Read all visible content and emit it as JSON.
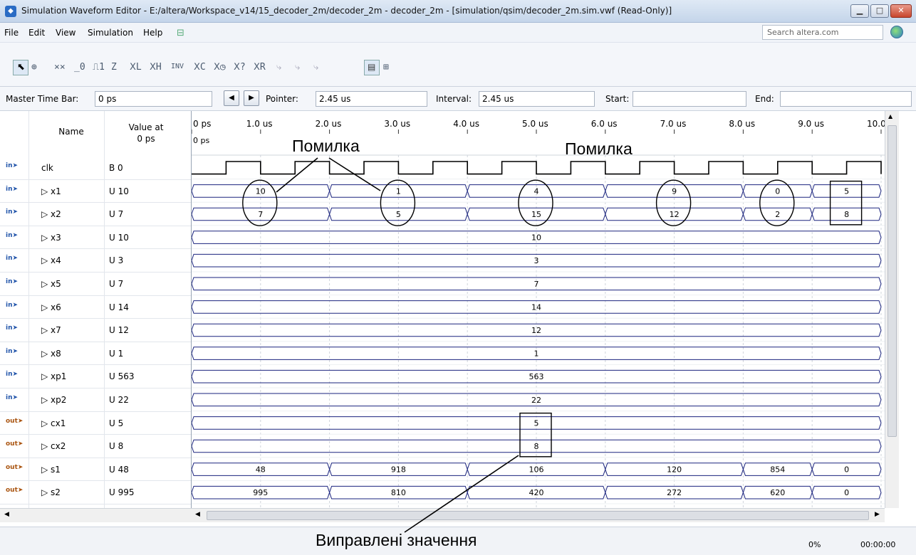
{
  "window": {
    "title": "Simulation Waveform Editor - E:/altera/Workspace_v14/15_decoder_2m/decoder_2m - decoder_2m - [simulation/qsim/decoder_2m.sim.vwf (Read-Only)]"
  },
  "menu": {
    "items": [
      "File",
      "Edit",
      "View",
      "Simulation",
      "Help"
    ]
  },
  "search": {
    "placeholder": "Search altera.com"
  },
  "toolbar": {
    "icons": [
      "select-icon",
      "zoom-icon",
      "uninitialized-icon",
      "forcing-low-icon",
      "forcing-high-icon",
      "high-impedance-icon",
      "weak-low-icon",
      "weak-high-icon",
      "invert-icon",
      "count-value-icon",
      "clock-icon",
      "random-icon",
      "arbitrary-value-icon",
      "snap-to-grid-icon",
      "grid-icon"
    ]
  },
  "timebar": {
    "master_label": "Master Time Bar:",
    "master_value": "0 ps",
    "pointer_label": "Pointer:",
    "pointer_value": "2.45 us",
    "interval_label": "Interval:",
    "interval_value": "2.45 us",
    "start_label": "Start:",
    "start_value": "",
    "end_label": "End:",
    "end_value": ""
  },
  "columns": {
    "name": "Name",
    "value_at": "Value at",
    "value_time": "0 ps"
  },
  "time_axis": {
    "ticks": [
      "0 ps",
      "1.0 us",
      "2.0 us",
      "3.0 us",
      "4.0 us",
      "5.0 us",
      "6.0 us",
      "7.0 us",
      "8.0 us",
      "9.0 us",
      "10.0 us"
    ],
    "cursor_label": "0 ps",
    "end_us": 10.0
  },
  "signals": [
    {
      "name": "clk",
      "value": "B 0",
      "dir": "in",
      "type": "clock"
    },
    {
      "name": "x1",
      "value": "U 10",
      "dir": "in",
      "type": "bus",
      "segments": [
        {
          "from": 0,
          "to": 2,
          "label": "10"
        },
        {
          "from": 2,
          "to": 4,
          "label": "1"
        },
        {
          "from": 4,
          "to": 6,
          "label": "4"
        },
        {
          "from": 6,
          "to": 8,
          "label": "9"
        },
        {
          "from": 8,
          "to": 9,
          "label": "0"
        },
        {
          "from": 9,
          "to": 10,
          "label": "5"
        }
      ]
    },
    {
      "name": "x2",
      "value": "U 7",
      "dir": "in",
      "type": "bus",
      "segments": [
        {
          "from": 0,
          "to": 2,
          "label": "7"
        },
        {
          "from": 2,
          "to": 4,
          "label": "5"
        },
        {
          "from": 4,
          "to": 6,
          "label": "15"
        },
        {
          "from": 6,
          "to": 8,
          "label": "12"
        },
        {
          "from": 8,
          "to": 9,
          "label": "2"
        },
        {
          "from": 9,
          "to": 10,
          "label": "8"
        }
      ]
    },
    {
      "name": "x3",
      "value": "U 10",
      "dir": "in",
      "type": "bus",
      "segments": [
        {
          "from": 0,
          "to": 10,
          "label": "10"
        }
      ]
    },
    {
      "name": "x4",
      "value": "U 3",
      "dir": "in",
      "type": "bus",
      "segments": [
        {
          "from": 0,
          "to": 10,
          "label": "3"
        }
      ]
    },
    {
      "name": "x5",
      "value": "U 7",
      "dir": "in",
      "type": "bus",
      "segments": [
        {
          "from": 0,
          "to": 10,
          "label": "7"
        }
      ]
    },
    {
      "name": "x6",
      "value": "U 14",
      "dir": "in",
      "type": "bus",
      "segments": [
        {
          "from": 0,
          "to": 10,
          "label": "14"
        }
      ]
    },
    {
      "name": "x7",
      "value": "U 12",
      "dir": "in",
      "type": "bus",
      "segments": [
        {
          "from": 0,
          "to": 10,
          "label": "12"
        }
      ]
    },
    {
      "name": "x8",
      "value": "U 1",
      "dir": "in",
      "type": "bus",
      "segments": [
        {
          "from": 0,
          "to": 10,
          "label": "1"
        }
      ]
    },
    {
      "name": "xp1",
      "value": "U 563",
      "dir": "in",
      "type": "bus",
      "segments": [
        {
          "from": 0,
          "to": 10,
          "label": "563"
        }
      ]
    },
    {
      "name": "xp2",
      "value": "U 22",
      "dir": "in",
      "type": "bus",
      "segments": [
        {
          "from": 0,
          "to": 10,
          "label": "22"
        }
      ]
    },
    {
      "name": "cx1",
      "value": "U 5",
      "dir": "out",
      "type": "bus",
      "segments": [
        {
          "from": 0,
          "to": 10,
          "label": "5"
        }
      ]
    },
    {
      "name": "cx2",
      "value": "U 8",
      "dir": "out",
      "type": "bus",
      "segments": [
        {
          "from": 0,
          "to": 10,
          "label": "8"
        }
      ]
    },
    {
      "name": "s1",
      "value": "U 48",
      "dir": "out",
      "type": "bus",
      "segments": [
        {
          "from": 0,
          "to": 2,
          "label": "48"
        },
        {
          "from": 2,
          "to": 4,
          "label": "918"
        },
        {
          "from": 4,
          "to": 6,
          "label": "106"
        },
        {
          "from": 6,
          "to": 8,
          "label": "120"
        },
        {
          "from": 8,
          "to": 9,
          "label": "854"
        },
        {
          "from": 9,
          "to": 10,
          "label": "0"
        }
      ]
    },
    {
      "name": "s2",
      "value": "U 995",
      "dir": "out",
      "type": "bus",
      "segments": [
        {
          "from": 0,
          "to": 2,
          "label": "995"
        },
        {
          "from": 2,
          "to": 4,
          "label": "810"
        },
        {
          "from": 4,
          "to": 6,
          "label": "420"
        },
        {
          "from": 6,
          "to": 8,
          "label": "272"
        },
        {
          "from": 8,
          "to": 9,
          "label": "620"
        },
        {
          "from": 9,
          "to": 10,
          "label": "0"
        }
      ]
    }
  ],
  "annotations": {
    "error_label_1": "Помилка",
    "error_label_2": "Помилка",
    "fixed_label": "Виправлені значення"
  },
  "status": {
    "progress": "0%",
    "time": "00:00:00"
  },
  "colors": {
    "wave": "#1a237e",
    "clock": "#000000"
  }
}
